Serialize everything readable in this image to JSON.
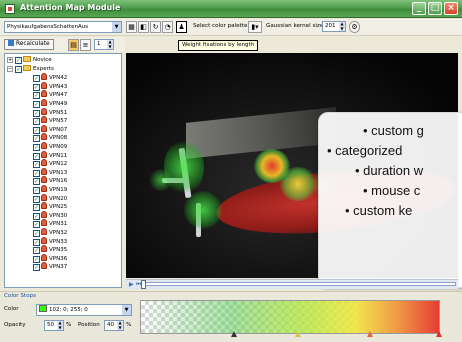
{
  "window": {
    "title": "Attention Map Module",
    "controls": [
      "_",
      "□",
      "×"
    ]
  },
  "toolbar": {
    "dataset_value": "PhysikaufgabensSchattenAus",
    "select_palette_label": "Select color palette",
    "kernel_label": "Gaussian kernel size",
    "kernel_value": "201",
    "tooltip": "Weight fixations by length",
    "recalculate_label": "Recalculate",
    "step_value": "1"
  },
  "tree": {
    "groups": [
      {
        "label": "Novice",
        "expander": "+"
      },
      {
        "label": "Experts",
        "expander": "−"
      }
    ],
    "subjects": [
      "VPN42",
      "VPN43",
      "VPN47",
      "VPN49",
      "VPN51",
      "VPN57",
      "VPN07",
      "VPN08",
      "VPN09",
      "VPN11",
      "VPN12",
      "VPN13",
      "VPN16",
      "VPN19",
      "VPN20",
      "VPN25",
      "VPN30",
      "VPN31",
      "VPN32",
      "VPN33",
      "VPN35",
      "VPN36",
      "VPN37"
    ]
  },
  "callout": {
    "lines": [
      "• custom g",
      "• categorized",
      "• duration w",
      "• mouse c",
      "• custom ke"
    ]
  },
  "color_stops": {
    "title": "Color Stops",
    "color_label": "Color",
    "color_value": "102; 0; 255; 0",
    "opacity_label": "Opacity",
    "opacity_value": "50",
    "opacity_unit": "%",
    "position_label": "Position",
    "position_value": "40",
    "position_unit": "%"
  },
  "colors": {
    "titlebar": "#4f9d4c",
    "accent": "#1d4e9e",
    "heat_green": "#36d136",
    "heat_red": "#e0302a",
    "heat_yellow": "#ffe24a"
  }
}
